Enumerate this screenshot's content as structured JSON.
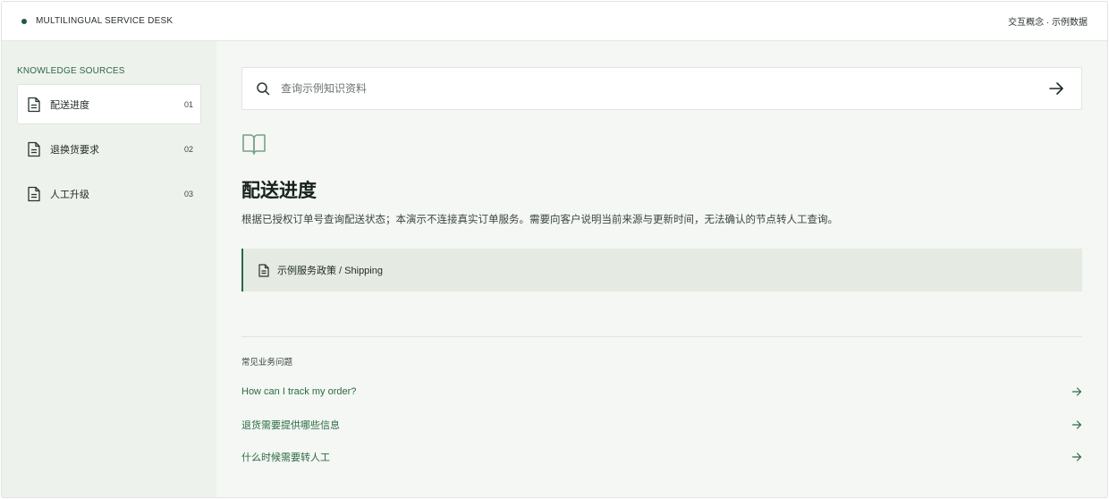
{
  "header": {
    "brand": "MULTILINGUAL SERVICE DESK",
    "right_text": "交互概念 · 示例数据"
  },
  "sidebar": {
    "heading": "KNOWLEDGE SOURCES",
    "items": [
      {
        "label": "配送进度",
        "num": "01",
        "active": true
      },
      {
        "label": "退换货要求",
        "num": "02",
        "active": false
      },
      {
        "label": "人工升级",
        "num": "03",
        "active": false
      }
    ]
  },
  "search": {
    "placeholder": "查询示例知识资料",
    "value": ""
  },
  "article": {
    "title": "配送进度",
    "description": "根据已授权订单号查询配送状态；本演示不连接真实订单服务。需要向客户说明当前来源与更新时间，无法确认的节点转人工查询。",
    "source_label": "示例服务政策 / Shipping"
  },
  "faq": {
    "heading": "常见业务问题",
    "items": [
      {
        "q": "How can I track my order?"
      },
      {
        "q": "退货需要提供哪些信息"
      },
      {
        "q": "什么时候需要转人工"
      }
    ]
  },
  "colors": {
    "accent": "#2b6a45",
    "dot": "#1f5a3c",
    "background": "#f4f7f3",
    "sidebar": "#eef2ec"
  }
}
